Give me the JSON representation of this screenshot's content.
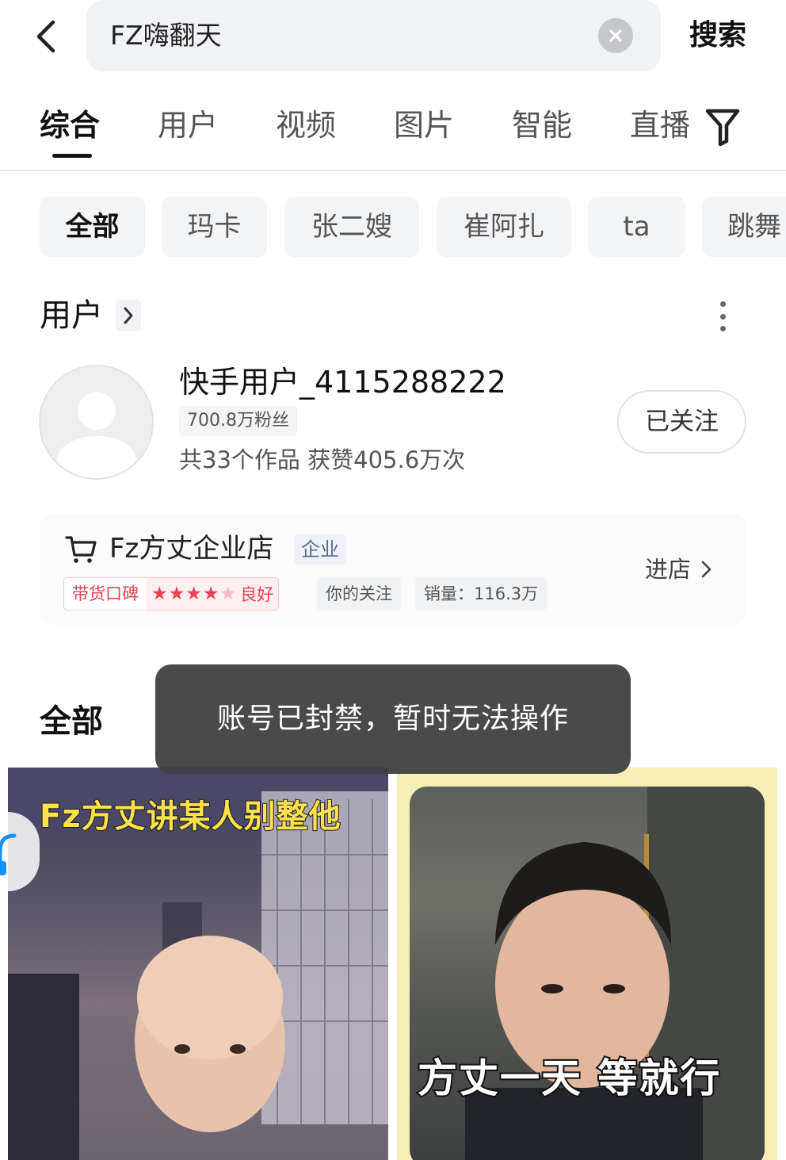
{
  "search": {
    "query": "FZ嗨翻天",
    "submit_label": "搜索"
  },
  "tabs": [
    {
      "label": "综合",
      "active": true
    },
    {
      "label": "用户",
      "active": false
    },
    {
      "label": "视频",
      "active": false
    },
    {
      "label": "图片",
      "active": false
    },
    {
      "label": "智能",
      "active": false
    },
    {
      "label": "直播",
      "active": false
    }
  ],
  "chips": [
    {
      "label": "全部",
      "active": true
    },
    {
      "label": "玛卡",
      "active": false
    },
    {
      "label": "张二嫂",
      "active": false
    },
    {
      "label": "崔阿扎",
      "active": false
    },
    {
      "label": "ta",
      "active": false
    },
    {
      "label": "跳舞",
      "active": false
    }
  ],
  "user_section": {
    "title": "用户"
  },
  "user": {
    "name": "快手用户_4115288222",
    "fans": "700.8万粉丝",
    "stats": "共33个作品 获赞405.6万次",
    "follow_label": "已关注"
  },
  "shop": {
    "name": "Fz方丈企业店",
    "tag": "企业",
    "reputation_label": "带货口碑",
    "rating_stars": 4,
    "rating_max": 5,
    "reputation_level": "良好",
    "follow_info": "你的关注",
    "sales": "销量：116.3万",
    "enter_label": "进店"
  },
  "all_section": {
    "title": "全部"
  },
  "videos": [
    {
      "caption": "Fz方丈讲某人别整他"
    },
    {
      "caption": "方丈一天 等就行"
    }
  ],
  "toast": {
    "message": "账号已封禁，暂时无法操作"
  },
  "colors": {
    "accent_red": "#e8414f",
    "toast_bg": "#404040",
    "caption_yellow": "#ffe14a"
  },
  "icons": [
    "back-arrow-icon",
    "clear-icon",
    "filter-icon",
    "chevron-right-icon",
    "more-vertical-icon",
    "default-avatar-icon",
    "cart-icon",
    "star-icon",
    "headphones-icon"
  ]
}
